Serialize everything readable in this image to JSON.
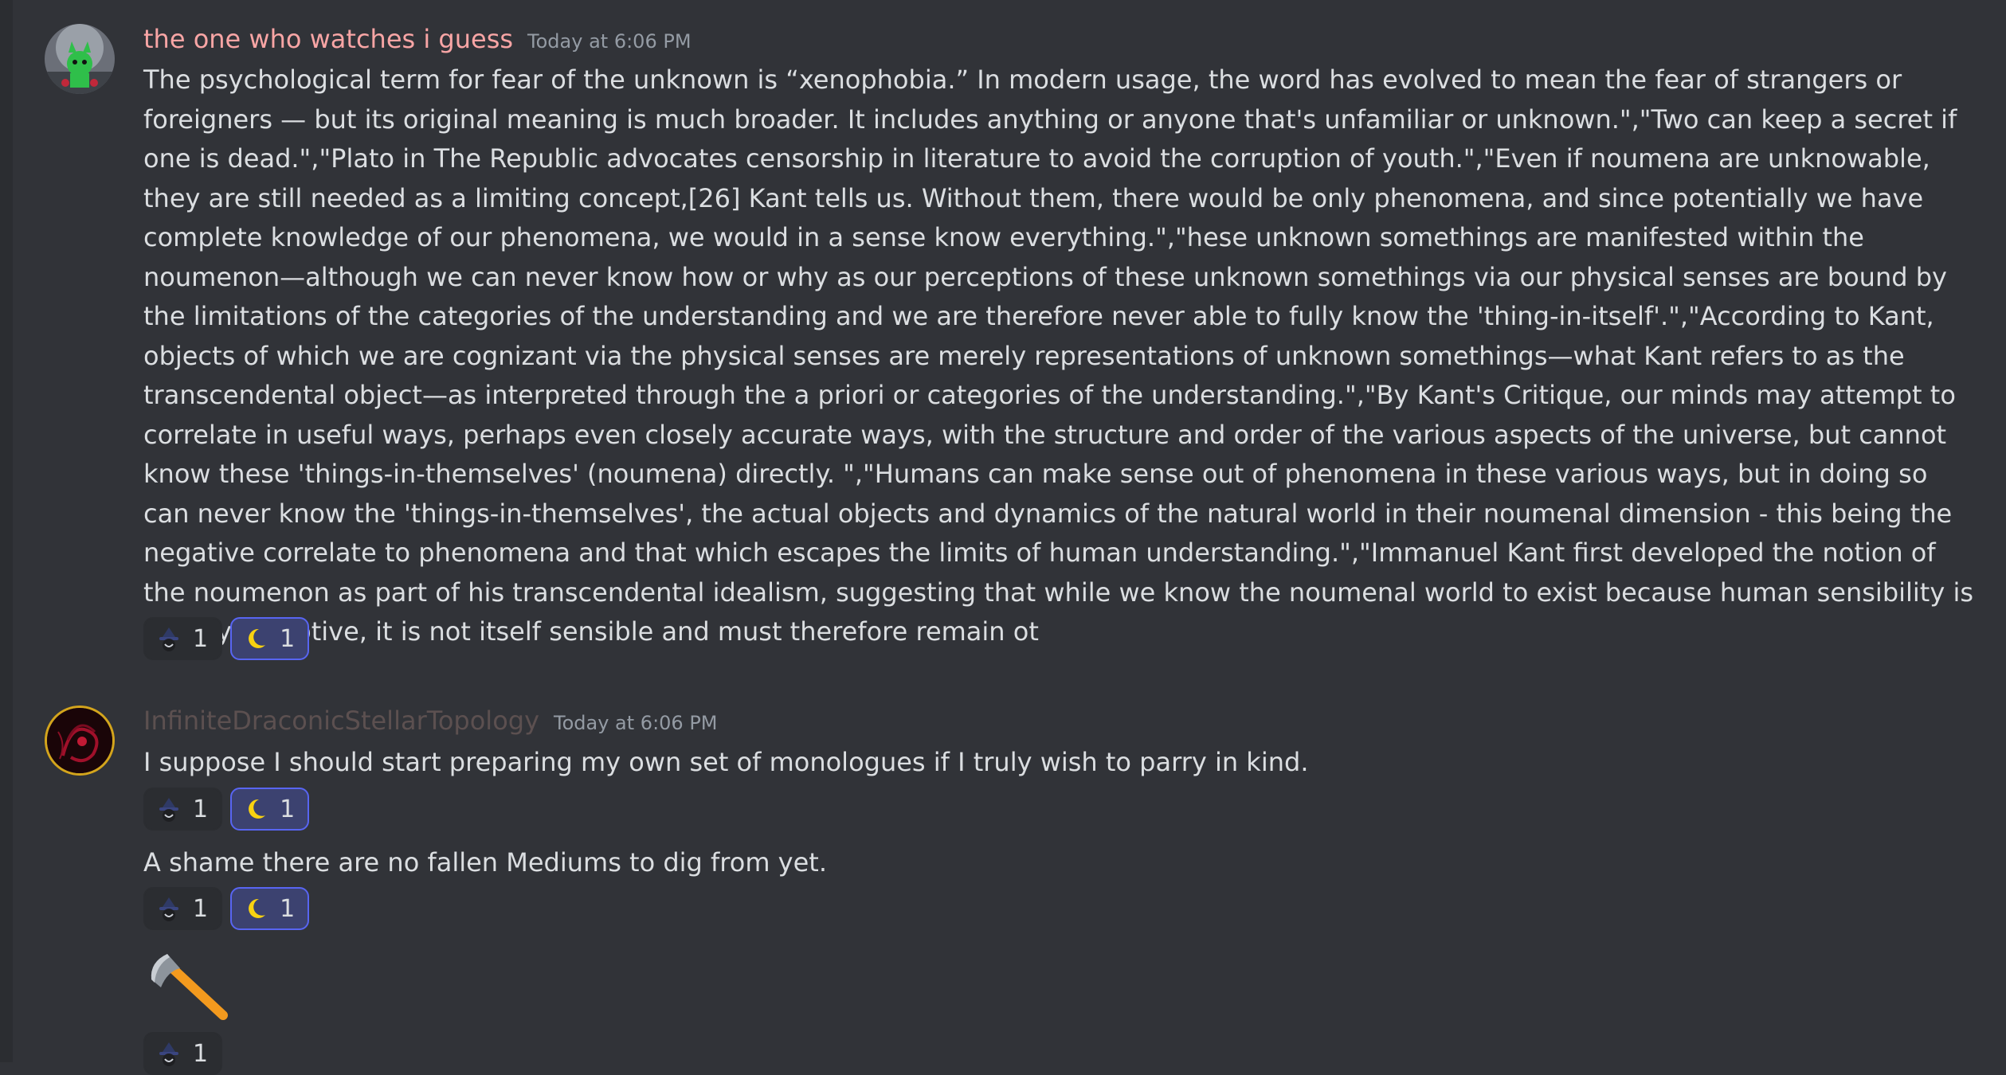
{
  "messages": [
    {
      "author": "the one who watches i guess",
      "author_color": "#f8a5a5",
      "timestamp": "Today at 6:06 PM",
      "text": "The psychological term for fear of the unknown is “xenophobia.” In modern usage, the word has evolved to mean the fear of strangers or foreigners — but its original meaning is much broader. It includes anything or anyone that's unfamiliar or unknown.\",\"Two can keep a secret if one is dead.\",\"Plato in The Republic advocates censorship in literature to avoid the corruption of youth.\",\"Even if noumena are unknowable, they are still needed as a limiting concept,[26] Kant tells us. Without them, there would be only phenomena, and since potentially we have complete knowledge of our phenomena, we would in a sense know everything.\",\"hese unknown somethings are manifested within the noumenon—although we can never know how or why as our perceptions of these unknown somethings via our physical senses are bound by the limitations of the categories of the understanding and we are therefore never able to fully know the 'thing-in-itself'.\",\"According to Kant, objects of which we are cognizant via the physical senses are merely representations of unknown somethings—what Kant refers to as the transcendental object—as interpreted through the a priori or categories of the understanding.\",\"By Kant's Critique, our minds may attempt to correlate in useful ways, perhaps even closely accurate ways, with the structure and order of the various aspects of the universe, but cannot know these 'things-in-themselves' (noumena) directly. \",\"Humans can make sense out of phenomena in these various ways, but in doing so can never know the 'things-in-themselves', the actual objects and dynamics of the natural world in their noumenal dimension - this being the negative correlate to phenomena and that which escapes the limits of human understanding.\",\"Immanuel Kant first developed the notion of the noumenon as part of his transcendental idealism, suggesting that while we know the noumenal world to exist because human sensibility is merely receptive, it is not itself sensible and must therefore remain ot",
      "reactions": [
        {
          "icon": "witch-hat-face-icon",
          "count": "1"
        },
        {
          "icon": "crescent-moon-icon",
          "count": "1"
        }
      ]
    },
    {
      "author": "InfiniteDraconicStellarTopology",
      "author_color": "#5c5050",
      "timestamp": "Today at 6:06 PM",
      "text": "I suppose I should start preparing my own set of monologues if I truly wish to parry in kind.",
      "reactions": [
        {
          "icon": "witch-hat-face-icon",
          "count": "1"
        },
        {
          "icon": "crescent-moon-icon",
          "count": "1"
        }
      ]
    },
    {
      "text": "A shame there are no fallen Mediums to dig from yet.",
      "reactions": [
        {
          "icon": "witch-hat-face-icon",
          "count": "1"
        },
        {
          "icon": "crescent-moon-icon",
          "count": "1"
        }
      ]
    },
    {
      "emoji": "axe-icon",
      "reactions": [
        {
          "icon": "witch-hat-face-icon",
          "count": "1"
        }
      ]
    }
  ],
  "colors": {
    "background": "#313338",
    "reaction_active_border": "#5865f2",
    "moon": "#f8d210"
  }
}
